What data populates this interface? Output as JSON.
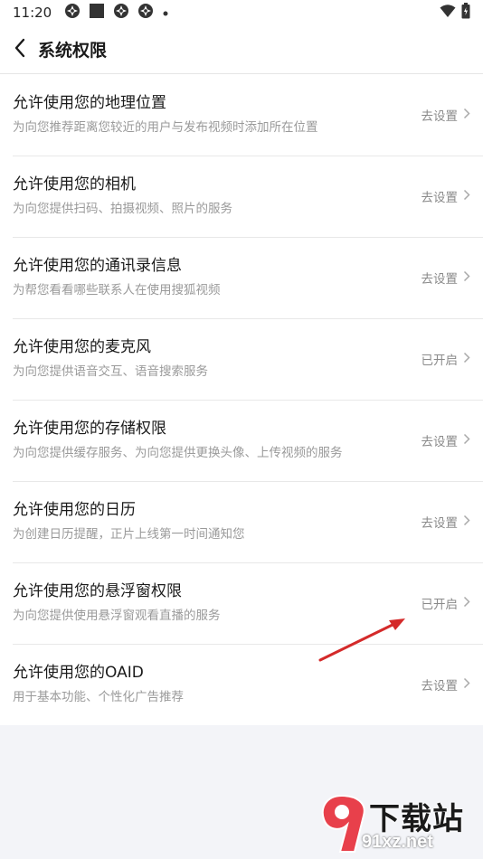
{
  "status_bar": {
    "time": "11:20",
    "icons": [
      "app-icon",
      "stop-icon",
      "app-icon",
      "app-icon",
      "dot-icon"
    ],
    "right_icons": [
      "wifi-icon",
      "battery-icon"
    ]
  },
  "header": {
    "title": "系统权限",
    "back_icon": "chevron-left-icon"
  },
  "permissions": [
    {
      "title": "允许使用您的地理位置",
      "desc": "为向您推荐距离您较近的用户与发布视频时添加所在位置",
      "action": "去设置"
    },
    {
      "title": "允许使用您的相机",
      "desc": "为向您提供扫码、拍摄视频、照片的服务",
      "action": "去设置"
    },
    {
      "title": "允许使用您的通讯录信息",
      "desc": "为帮您看看哪些联系人在使用搜狐视频",
      "action": "去设置"
    },
    {
      "title": "允许使用您的麦克风",
      "desc": "为向您提供语音交互、语音搜索服务",
      "action": "已开启"
    },
    {
      "title": "允许使用您的存储权限",
      "desc": "为向您提供缓存服务、为向您提供更换头像、上传视频的服务",
      "action": "去设置"
    },
    {
      "title": "允许使用您的日历",
      "desc": "为创建日历提醒，正片上线第一时间通知您",
      "action": "去设置"
    },
    {
      "title": "允许使用您的悬浮窗权限",
      "desc": "为向您提供使用悬浮窗观看直播的服务",
      "action": "已开启"
    },
    {
      "title": "允许使用您的OAID",
      "desc": "用于基本功能、个性化广告推荐",
      "action": "去设置"
    }
  ],
  "annotation": {
    "arrow_color": "#d42a2a"
  },
  "watermark": {
    "text": "下载站",
    "url": "91xz.net",
    "logo_color": "#e8404b"
  }
}
